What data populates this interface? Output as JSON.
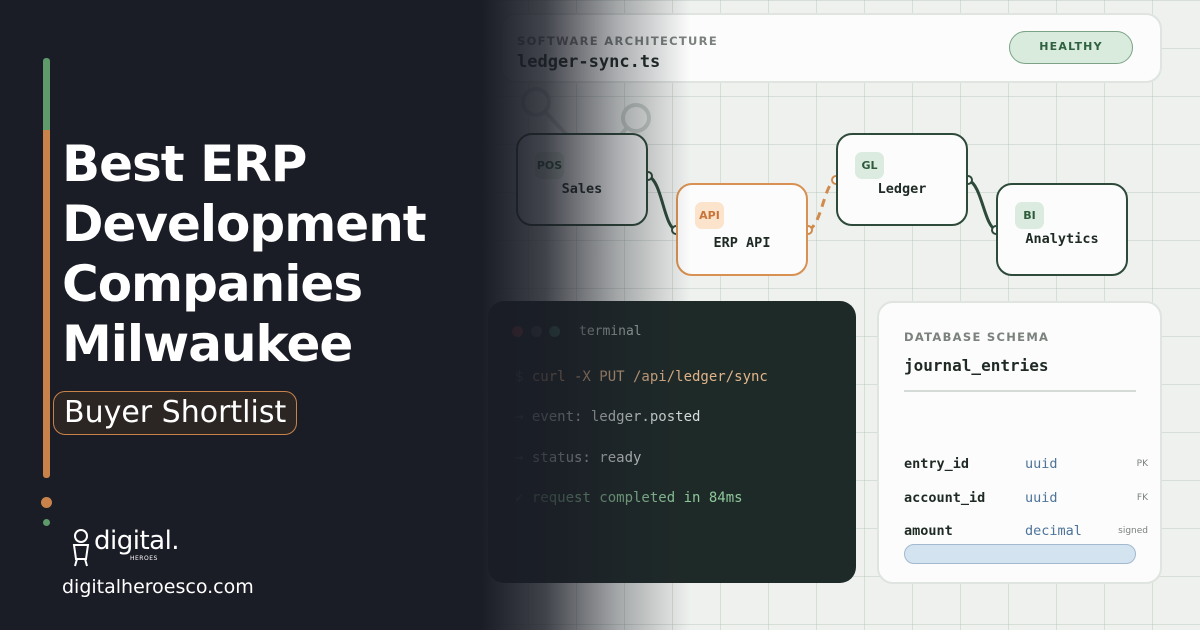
{
  "headline": {
    "lines": [
      "Best ERP",
      "Development",
      "Companies",
      "Milwaukee"
    ],
    "tag": "Buyer Shortlist"
  },
  "brand": {
    "logo_word": "digital.",
    "logo_sub": "HEROES",
    "website": "digitalheroesco.com"
  },
  "architecture": {
    "section_label": "SOFTWARE ARCHITECTURE",
    "file_name": "ledger-sync.ts",
    "status_badge": "HEALTHY",
    "nodes": [
      {
        "badge": "POS",
        "label": "Sales"
      },
      {
        "badge": "API",
        "label": "ERP API"
      },
      {
        "badge": "GL",
        "label": "Ledger"
      },
      {
        "badge": "BI",
        "label": "Analytics"
      }
    ]
  },
  "terminal": {
    "title": "terminal",
    "lines": [
      {
        "prefix": "$ ",
        "text": "curl -X PUT /api/ledger/sync"
      },
      {
        "prefix": "→ ",
        "text": "event: ledger.posted"
      },
      {
        "prefix": "→ ",
        "text": "status: ready"
      },
      {
        "prefix": "✓ ",
        "text": "request completed in 84ms"
      }
    ]
  },
  "schema": {
    "section_label": "DATABASE SCHEMA",
    "table_name": "journal_entries",
    "columns": [
      {
        "name": "entry_id",
        "type": "uuid",
        "key": "PK"
      },
      {
        "name": "account_id",
        "type": "uuid",
        "key": "FK"
      },
      {
        "name": "amount",
        "type": "decimal",
        "key": "signed"
      }
    ]
  },
  "colors": {
    "dark_bg": "#1a1c26",
    "light_bg": "#eef1ee",
    "accent_orange": "#c9834a",
    "accent_green": "#5e9a6a",
    "terminal_bg": "#1e2a28"
  }
}
